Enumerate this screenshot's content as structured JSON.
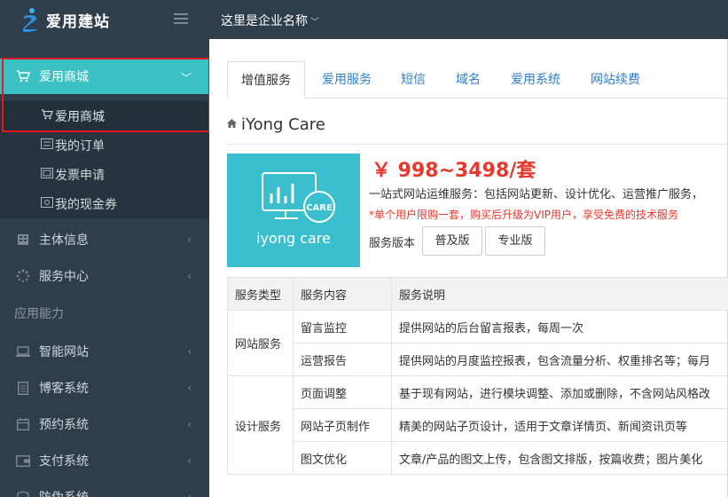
{
  "header": {
    "logo_text": "爱用建站",
    "company_name": "这里是企业名称"
  },
  "sidebar": {
    "mall": {
      "label": "爱用商城"
    },
    "sub_items": [
      {
        "label": "爱用商城"
      },
      {
        "label": "我的订单"
      },
      {
        "label": "发票申请"
      },
      {
        "label": "我的现金券"
      }
    ],
    "items": [
      {
        "label": "主体信息"
      },
      {
        "label": "服务中心"
      }
    ],
    "section_label": "应用能力",
    "app_items": [
      {
        "label": "智能网站"
      },
      {
        "label": "博客系统"
      },
      {
        "label": "预约系统"
      },
      {
        "label": "支付系统"
      },
      {
        "label": "防伪系统"
      }
    ]
  },
  "tabs": [
    {
      "label": "增值服务",
      "active": true
    },
    {
      "label": "爱用服务"
    },
    {
      "label": "短信"
    },
    {
      "label": "域名"
    },
    {
      "label": "爱用系统"
    },
    {
      "label": "网站续费"
    }
  ],
  "product": {
    "title": "iYong Care",
    "image_badge": "CARE",
    "image_caption": "iyong care",
    "price": "￥ 998~3498/套",
    "description": "一站式网站运维服务：包括网站更新、设计优化、运营推广服务，",
    "note": "*单个用户限购一套，购买后升级为VIP用户，享受免费的技术服务",
    "version_label": "服务版本",
    "versions": [
      "普及版",
      "专业版"
    ]
  },
  "table": {
    "headers": [
      "服务类型",
      "服务内容",
      "服务说明"
    ],
    "groups": [
      {
        "type": "网站服务",
        "rows": [
          {
            "content": "留言监控",
            "detail": "提供网站的后台留言报表，每周一次"
          },
          {
            "content": "运营报告",
            "detail": "提供网站的月度监控报表，包含流量分析、权重排名等；每月"
          }
        ]
      },
      {
        "type": "设计服务",
        "rows": [
          {
            "content": "页面调整",
            "detail": "基于现有网站，进行模块调整、添加或删除，不含网站风格改"
          },
          {
            "content": "网站子页制作",
            "detail": "精美的网站子页设计，适用于文章详情页、新闻资讯页等"
          },
          {
            "content": "图文优化",
            "detail": "文章/产品的图文上传，包含图文排版，按篇收费；图片美化"
          }
        ]
      }
    ]
  },
  "colors": {
    "sidebar_bg": "#2f3e4b",
    "accent": "#3bc0c3",
    "price_red": "#e8372c",
    "link_blue": "#2c7fc8",
    "highlight_frame": "#e3191f"
  }
}
